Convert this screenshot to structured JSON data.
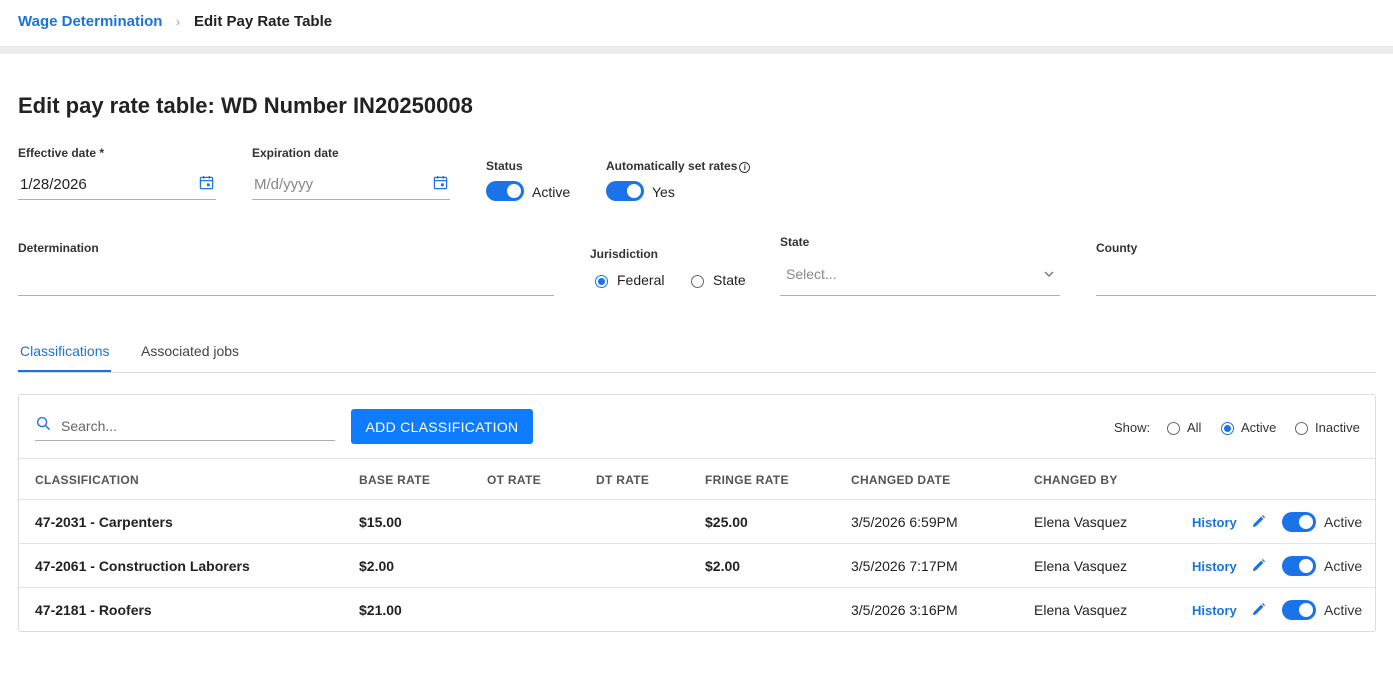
{
  "breadcrumb": {
    "parent": "Wage Determination",
    "separator": "›",
    "current": "Edit Pay Rate Table"
  },
  "page_title": "Edit pay rate table: WD Number IN20250008",
  "form": {
    "effective_date": {
      "label": "Effective date *",
      "value": "1/28/2026"
    },
    "expiration_date": {
      "label": "Expiration date",
      "placeholder": "M/d/yyyy"
    },
    "status": {
      "label": "Status",
      "value": "Active",
      "on": true
    },
    "auto_set_rates": {
      "label": "Automatically set rates",
      "value": "Yes",
      "on": true
    },
    "determination": {
      "label": "Determination"
    },
    "jurisdiction": {
      "label": "Jurisdiction",
      "options": [
        "Federal",
        "State"
      ],
      "selected": "Federal"
    },
    "state": {
      "label": "State",
      "placeholder": "Select..."
    },
    "county": {
      "label": "County"
    }
  },
  "tabs": [
    {
      "label": "Classifications",
      "active": true
    },
    {
      "label": "Associated jobs",
      "active": false
    }
  ],
  "toolbar": {
    "search_placeholder": "Search...",
    "add_button": "ADD CLASSIFICATION",
    "show_label": "Show:",
    "show_options": [
      "All",
      "Active",
      "Inactive"
    ],
    "show_selected": "Active"
  },
  "table": {
    "columns": [
      "CLASSIFICATION",
      "BASE RATE",
      "OT RATE",
      "DT RATE",
      "FRINGE RATE",
      "CHANGED DATE",
      "CHANGED BY"
    ],
    "rows": [
      {
        "classification": "47-2031 - Carpenters",
        "base_rate": "$15.00",
        "ot_rate": "",
        "dt_rate": "",
        "fringe_rate": "$25.00",
        "changed_date": "3/5/2026 6:59PM",
        "changed_by": "Elena Vasquez",
        "history": "History",
        "status": "Active"
      },
      {
        "classification": "47-2061 - Construction Laborers",
        "base_rate": "$2.00",
        "ot_rate": "",
        "dt_rate": "",
        "fringe_rate": "$2.00",
        "changed_date": "3/5/2026 7:17PM",
        "changed_by": "Elena Vasquez",
        "history": "History",
        "status": "Active"
      },
      {
        "classification": "47-2181 - Roofers",
        "base_rate": "$21.00",
        "ot_rate": "",
        "dt_rate": "",
        "fringe_rate": "",
        "changed_date": "3/5/2026 3:16PM",
        "changed_by": "Elena Vasquez",
        "history": "History",
        "status": "Active"
      }
    ]
  },
  "colors": {
    "accent": "#1a73e8",
    "link": "#1a73d9",
    "button": "#0f7bff"
  },
  "icons": {
    "calendar": "calendar-icon",
    "info": "info-icon",
    "chevron": "chevron-down-icon",
    "search": "search-icon",
    "edit": "pencil-icon"
  }
}
